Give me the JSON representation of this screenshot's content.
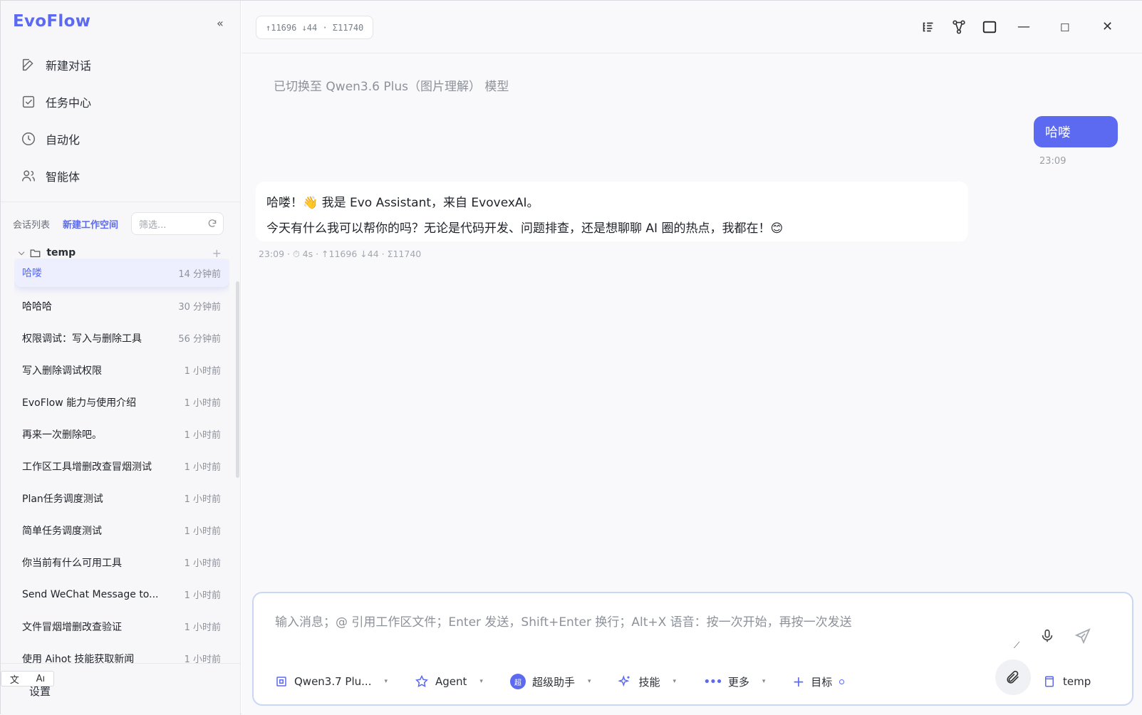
{
  "app": {
    "name": "EvoFlow"
  },
  "sidebar": {
    "collapse_label": "«",
    "nav": [
      {
        "label": "新建对话",
        "icon": "edit-icon"
      },
      {
        "label": "任务中心",
        "icon": "checkbox-icon"
      },
      {
        "label": "自动化",
        "icon": "clock-icon"
      },
      {
        "label": "智能体",
        "icon": "users-icon"
      }
    ],
    "session_list_label": "会话列表",
    "new_workspace_label": "新建工作空间",
    "filter_placeholder": "筛选...",
    "folder": {
      "name": "temp",
      "add_label": "+"
    },
    "conversations": [
      {
        "title": "哈喽",
        "time": "14 分钟前"
      },
      {
        "title": "哈哈哈",
        "time": "30 分钟前"
      },
      {
        "title": "权限调试：写入与删除工具",
        "time": "56 分钟前"
      },
      {
        "title": "写入删除调试权限",
        "time": "1 小时前"
      },
      {
        "title": "EvoFlow 能力与使用介绍",
        "time": "1 小时前"
      },
      {
        "title": "再来一次删除吧。",
        "time": "1 小时前"
      },
      {
        "title": "工作区工具增删改查冒烟测试",
        "time": "1 小时前"
      },
      {
        "title": "Plan任务调度测试",
        "time": "1 小时前"
      },
      {
        "title": "简单任务调度测试",
        "time": "1 小时前"
      },
      {
        "title": "你当前有什么可用工具",
        "time": "1 小时前"
      },
      {
        "title": "Send WeChat Message to...",
        "time": "1 小时前"
      },
      {
        "title": "文件冒烟增删改查验证",
        "time": "1 小时前"
      },
      {
        "title": "使用 Aihot 技能获取新闻",
        "time": "1 小时前"
      }
    ],
    "settings_label": "设置",
    "ime": {
      "a": "文",
      "b": "Aı"
    }
  },
  "topbar": {
    "token_stats": "↑11696 ↓44 · Σ11740",
    "window": {
      "minimize": "—",
      "maximize": "☐",
      "close": "✕"
    }
  },
  "chat": {
    "system_notice": "已切换至 Qwen3.6 Plus（图片理解） 模型",
    "user_message": "哈喽",
    "user_time": "23:09",
    "assistant_line1": "哈喽！👋 我是 Evo Assistant，来自 EvovexAI。",
    "assistant_line2": "今天有什么我可以帮你的吗？无论是代码开发、问题排查，还是想聊聊 AI 圈的热点，我都在！😊",
    "assistant_meta": "23:09 · ⏱ 4s · ↑11696 ↓44 · Σ11740"
  },
  "composer": {
    "placeholder": "输入消息；@ 引用工作区文件；Enter 发送，Shift+Enter 换行；Alt+X 语音：按一次开始，再按一次发送",
    "model_label": "Qwen3.7 Plu...",
    "agent_label": "Agent",
    "assistant_label": "超级助手",
    "skills_label": "技能",
    "more_label": "更多",
    "goal_label": "目标",
    "workspace_label": "temp",
    "caret": "▾",
    "assistant_badge": "超"
  },
  "colors": {
    "accent": "#5b6af0"
  }
}
